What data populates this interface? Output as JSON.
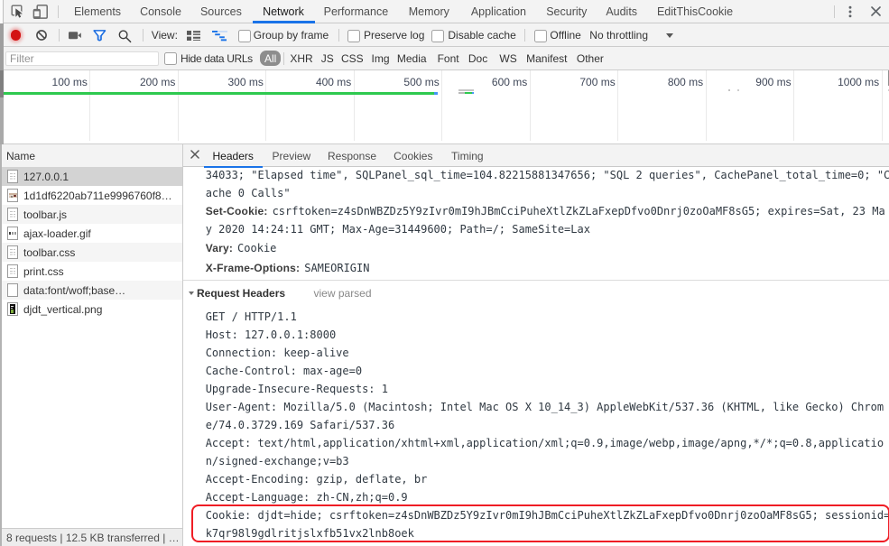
{
  "devtools": {
    "main_tabbar": {
      "icons": [
        "inspect-cursor-icon",
        "device-toolbar-icon",
        "kebab-menu-icon",
        "close-icon"
      ],
      "tabs": [
        {
          "label": "Elements"
        },
        {
          "label": "Console"
        },
        {
          "label": "Sources"
        },
        {
          "label": "Network",
          "selected": true
        },
        {
          "label": "Performance"
        },
        {
          "label": "Memory"
        },
        {
          "label": "Application"
        },
        {
          "label": "Security"
        },
        {
          "label": "Audits"
        },
        {
          "label": "EditThisCookie"
        }
      ],
      "selected_tab": "Network"
    },
    "network_toolbar": {
      "icons": [
        "record-icon",
        "clear-icon",
        "camera-icon",
        "filter-funnel-icon",
        "search-icon",
        "list-view-icon",
        "overview-waterfall-icon"
      ],
      "view_label": "View:",
      "checkboxes": [
        {
          "label": "Group by frame",
          "checked": false
        },
        {
          "label": "Preserve log",
          "checked": false
        },
        {
          "label": "Disable cache",
          "checked": false
        },
        {
          "label": "Offline",
          "checked": false
        }
      ],
      "throttling": {
        "value": "No throttling",
        "icon": "dropdown-arrow-icon"
      }
    },
    "filter_bar": {
      "input_placeholder": "Filter",
      "hide_data_urls_label": "Hide data URLs",
      "types": [
        "All",
        "XHR",
        "JS",
        "CSS",
        "Img",
        "Media",
        "Font",
        "Doc",
        "WS",
        "Manifest",
        "Other"
      ],
      "selected_type": "All"
    },
    "timeline_overview": {
      "tick_labels": [
        "100 ms",
        "200 ms",
        "300 ms",
        "400 ms",
        "500 ms",
        "600 ms",
        "700 ms",
        "800 ms",
        "900 ms",
        "1000 ms"
      ]
    },
    "request_table": {
      "column_header": "Name",
      "rows": [
        {
          "name": "127.0.0.1",
          "icon": "document-icon",
          "selected": true
        },
        {
          "name": "1d1df6220ab711e9996760f8…",
          "icon": "image-preview-icon"
        },
        {
          "name": "toolbar.js",
          "icon": "document-icon"
        },
        {
          "name": "ajax-loader.gif",
          "icon": "gif-preview-icon"
        },
        {
          "name": "toolbar.css",
          "icon": "document-icon"
        },
        {
          "name": "print.css",
          "icon": "document-icon"
        },
        {
          "name": "data:font/woff;base…",
          "icon": "blank-file-icon"
        },
        {
          "name": "djdt_vertical.png",
          "icon": "png-preview-icon"
        }
      ],
      "summary": "8 requests | 12.5 KB transferred | …"
    },
    "details_panel": {
      "close_icon": "close-icon",
      "tabs": [
        {
          "label": "Headers",
          "selected": true
        },
        {
          "label": "Preview"
        },
        {
          "label": "Response"
        },
        {
          "label": "Cookies"
        },
        {
          "label": "Timing"
        }
      ],
      "response_header_lines": [
        {
          "name": "",
          "value": "34033; \"Elapsed time\", SQLPanel_sql_time=104.82215881347656; \"SQL 2 queries\", CachePanel_total_time=0; \"C"
        },
        {
          "name": "",
          "value": "ache 0 Calls\""
        },
        {
          "name": "Set-Cookie:",
          "value": "csrftoken=z4sDnWBZDz5Y9zIvr0mI9hJBmCciPuheXtlZkZLaFxepDfvo0Dnrj0zoOaMF8sG5; expires=Sat, 23 Ma"
        },
        {
          "name": "",
          "value": "y 2020 14:24:11 GMT; Max-Age=31449600; Path=/; SameSite=Lax"
        },
        {
          "name": "Vary:",
          "value": "Cookie"
        },
        {
          "name": "X-Frame-Options:",
          "value": "SAMEORIGIN"
        }
      ],
      "request_headers_section": {
        "disclosure_icon": "triangle-down-icon",
        "title": "Request Headers",
        "action": "view parsed"
      },
      "request_header_lines": [
        "GET / HTTP/1.1",
        "Host: 127.0.0.1:8000",
        "Connection: keep-alive",
        "Cache-Control: max-age=0",
        "Upgrade-Insecure-Requests: 1",
        "User-Agent: Mozilla/5.0 (Macintosh; Intel Mac OS X 10_14_3) AppleWebKit/537.36 (KHTML, like Gecko) Chrom",
        "e/74.0.3729.169 Safari/537.36",
        "Accept: text/html,application/xhtml+xml,application/xml;q=0.9,image/webp,image/apng,*/*;q=0.8,applicatio",
        "n/signed-exchange;v=b3",
        "Accept-Encoding: gzip, deflate, br",
        "Accept-Language: zh-CN,zh;q=0.9",
        "Cookie: djdt=hide; csrftoken=z4sDnWBZDz5Y9zIvr0mI9hJBmCciPuheXtlZkZLaFxepDfvo0Dnrj0zoOaMF8sG5; sessionid=",
        "k7qr98l9gdlritjslxfb51vx2lnb8oek"
      ]
    },
    "colors": {
      "accent_blue": "#1a73e8",
      "record_red": "#d31414",
      "annotation_red": "#ef1d25",
      "waterfall_green": "#2ec94f",
      "waterfall_blue": "#4596f5",
      "waterfall_gray": "#c6c6c6"
    }
  }
}
